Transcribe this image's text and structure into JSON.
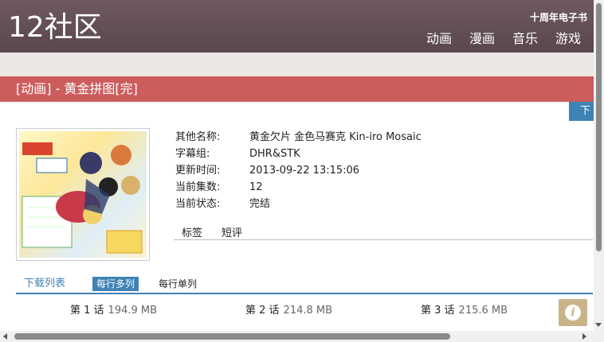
{
  "header": {
    "logo": "12社区",
    "anniversary": "十周年电子书",
    "nav": [
      "动画",
      "漫画",
      "音乐",
      "游戏"
    ]
  },
  "title": "[动画] - 黄金拼图[完]",
  "download_tab": "下",
  "info": {
    "rows": [
      {
        "k": "其他名称:",
        "v": "黄金欠片 金色马赛克 Kin-iro Mosaic"
      },
      {
        "k": "字幕组:",
        "v": "DHR&STK"
      },
      {
        "k": "更新时间:",
        "v": "2013-09-22 13:15:06"
      },
      {
        "k": "当前集数:",
        "v": "12"
      },
      {
        "k": "当前状态:",
        "v": "完结"
      }
    ],
    "tabs": [
      "标签",
      "短评"
    ]
  },
  "downloads": {
    "title": "下载列表",
    "tab_multi": "每行多列",
    "tab_single": "每行单列",
    "episodes": [
      {
        "label": "第 1 话",
        "size": "194.9 MB"
      },
      {
        "label": "第 2 话",
        "size": "214.8 MB"
      },
      {
        "label": "第 3 话",
        "size": "215.6 MB"
      }
    ]
  },
  "colors": {
    "header": "#5f4b52",
    "title_bar": "#cd5c5c",
    "accent": "#3f82b4"
  }
}
